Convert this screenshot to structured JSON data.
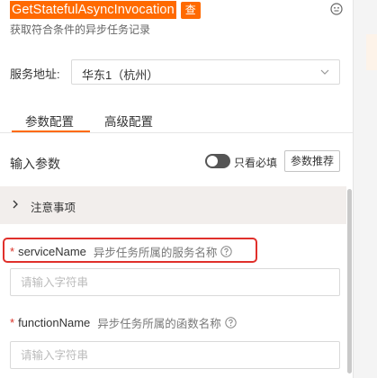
{
  "header": {
    "api_name": "GetStatefulAsyncInvocation",
    "query_badge": "查",
    "subtitle": "获取符合条件的异步任务记录"
  },
  "service_address": {
    "label": "服务地址:",
    "selected_region": "华东1（杭州）"
  },
  "tabs": [
    {
      "label": "参数配置",
      "active": true
    },
    {
      "label": "高级配置",
      "active": false
    }
  ],
  "input_params": {
    "title": "输入参数",
    "toggle_label": "只看必填",
    "toggle_on": false,
    "recommend_button": "参数推荐"
  },
  "notice": {
    "label": "注意事项"
  },
  "params": [
    {
      "required_mark": "*",
      "name": "serviceName",
      "description": "异步任务所属的服务名称",
      "placeholder": "请输入字符串",
      "value": ""
    },
    {
      "required_mark": "*",
      "name": "functionName",
      "description": "异步任务所属的函数名称",
      "placeholder": "请输入字符串",
      "value": ""
    }
  ],
  "colors": {
    "accent": "#ff6a00",
    "highlight": "#e0302b",
    "required": "#d93026"
  }
}
